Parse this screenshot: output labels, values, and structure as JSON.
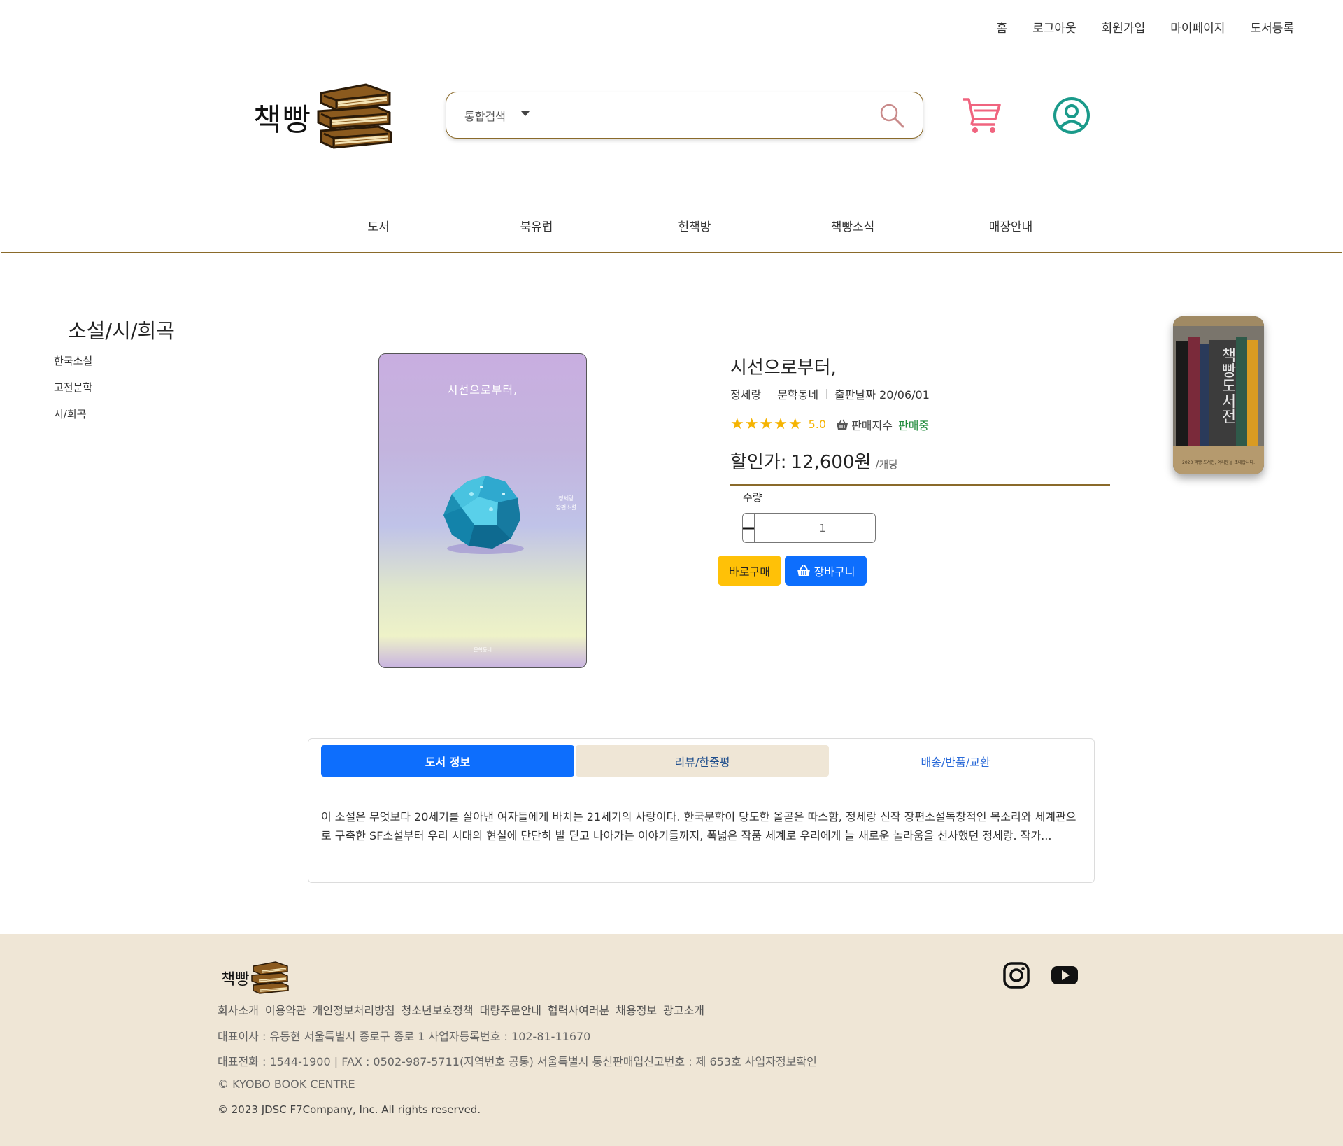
{
  "util_nav": [
    "홈",
    "로그아웃",
    "회원가입",
    "마이페이지",
    "도서등록"
  ],
  "logo": {
    "text": "책빵"
  },
  "search": {
    "type_label": "통합검색",
    "placeholder": ""
  },
  "main_nav": [
    "도서",
    "북유럽",
    "헌책방",
    "책빵소식",
    "매장안내"
  ],
  "category": {
    "title": "소설/시/희곡",
    "items": [
      "한국소설",
      "고전문학",
      "시/희곡"
    ]
  },
  "cover": {
    "title": "시선으로부터,",
    "side_text_1": "정세랑",
    "side_text_2": "장편소설",
    "publisher": "문학동네"
  },
  "book": {
    "title": "시선으로부터,",
    "author": "정세랑",
    "publisher": "문학동네",
    "pub_date": "출판날짜 20/06/01",
    "stars": "★★★★★",
    "rating": "5.0",
    "sales_label": "판매지수",
    "sales_status": "판매중",
    "price_label": "할인가:",
    "price_value": "12,600원",
    "price_unit": "/개당",
    "qty_label": "수량",
    "qty_value": "1",
    "buy_label": "바로구매",
    "cart_label": "장바구니"
  },
  "banner": {
    "title": "책빵도서전",
    "caption": "2023 책빵 도서전, 여러분을 초대합니다."
  },
  "tabs": {
    "items": [
      "도서 정보",
      "리뷰/한줄평",
      "배송/반품/교환"
    ],
    "content": "이 소설은 무엇보다 20세기를 살아낸 여자들에게 바치는 21세기의 사랑이다. 한국문학이 당도한 올곧은 따스함, 정세랑 신작 장편소설독창적인 목소리와 세계관으로 구축한 SF소설부터 우리 시대의 현실에 단단히 발 딛고 나아가는 이야기들까지, 폭넓은 작품 세계로 우리에게 늘 새로운 놀라움을 선사했던 정세랑. 작가..."
  },
  "footer": {
    "logo_text": "책빵",
    "links": [
      "회사소개",
      "이용약관",
      "개인정보처리방침",
      "청소년보호정책",
      "대량주문안내",
      "협력사여러분",
      "채용정보",
      "광고소개"
    ],
    "line1": "대표이사 : 유동현 서울특별시 종로구 종로 1 사업자등록번호 : 102-81-11670",
    "line2": "대표전화 : 1544-1900 | FAX : 0502-987-5711(지역번호 공통) 서울특별시 통신판매업신고번호 : 제 653호 사업자정보확인",
    "line3": "© KYOBO BOOK CENTRE",
    "line4": "© 2023 JDSC F7Company, Inc. All rights reserved."
  },
  "colors": {
    "accent_brown": "#8a6a2a",
    "primary_blue": "#0d6efd",
    "buy_yellow": "#ffc107",
    "star_yellow": "#f5b301",
    "footer_bg": "#efe6d6",
    "cart_pink": "#f0647f",
    "user_teal": "#1a9a8a"
  }
}
